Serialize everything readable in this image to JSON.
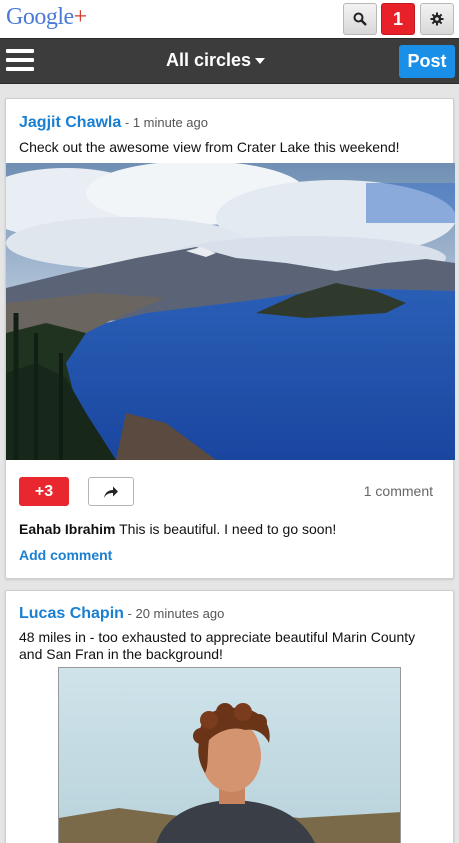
{
  "header": {
    "logo_google": "Google",
    "logo_plus": "+",
    "notification_count": "1"
  },
  "nav": {
    "circles_label": "All circles",
    "post_label": "Post"
  },
  "posts": [
    {
      "author": "Jagjit Chawla",
      "separator": " - ",
      "time": "1 minute ago",
      "text": "Check out the awesome view from Crater Lake this weekend!",
      "plus_label": "+3",
      "comment_count": "1 comment",
      "comment_author": "Eahab Ibrahim",
      "comment_text": "This is beautiful.  I need to go soon!",
      "add_comment": "Add comment"
    },
    {
      "author": "Lucas Chapin",
      "separator": " - ",
      "time": "20 minutes ago",
      "text_line1": "48 miles in - too exhausted to appreciate beautiful Marin County",
      "text_line2": "and San Fran in the background!"
    }
  ],
  "colors": {
    "link_blue": "#1a7fd1",
    "plus_red": "#e8282e",
    "post_blue": "#1a8fe8",
    "nav_dark": "#3c3c3c"
  },
  "icons": {
    "search": "magnifier-icon",
    "settings": "gear-icon",
    "menu": "hamburger-icon",
    "share": "share-arrow-icon"
  }
}
